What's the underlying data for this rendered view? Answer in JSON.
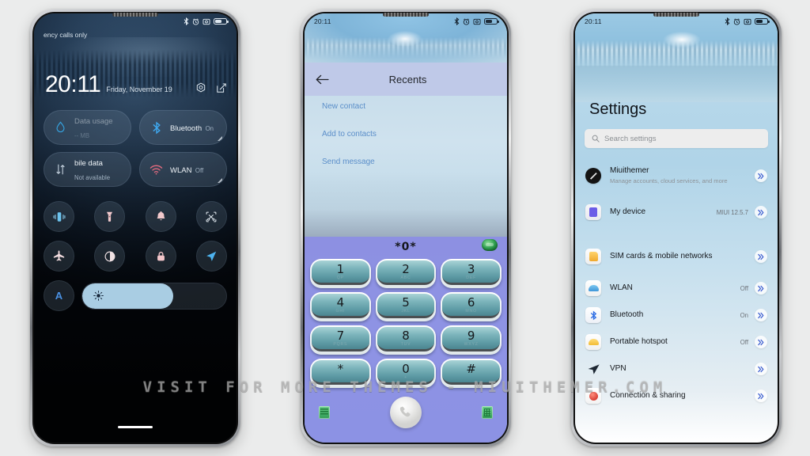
{
  "watermark": "VISIT FOR MORE THEMES - MIUITHEMER.COM",
  "colors": {
    "page_background": "#ebecec",
    "accent_blue": "#4f86c6",
    "dialpad_purple": "#8d90e2",
    "key_teal": "#5d9aa4",
    "brightness_fill": "#a9cde3",
    "settings_chevron": "#3e5fd0"
  },
  "phone1": {
    "status": {
      "carrier": "ency calls only",
      "icons": [
        "bluetooth-icon",
        "alarm-icon",
        "screenshot-icon",
        "battery-icon"
      ]
    },
    "lock": {
      "time": "20:11",
      "date": "Friday, November 19",
      "actions": [
        "camera-settings-icon",
        "edit-icon"
      ]
    },
    "tiles": [
      {
        "name": "Data usage",
        "sub": "-- MB",
        "icon": "data-drop-icon",
        "faded": true
      },
      {
        "name": "Bluetooth",
        "sub": "On",
        "icon": "bluetooth-icon",
        "faded": false
      },
      {
        "name": "bile data",
        "sub": "Not available",
        "icon": "mobile-data-icon",
        "faded": false
      },
      {
        "name": "WLAN",
        "sub": "Off",
        "icon": "wifi-icon",
        "faded": false
      }
    ],
    "quick_toggles": [
      "vibrate-icon",
      "flashlight-icon",
      "ringer-bell-icon",
      "screenshot-scissors-icon",
      "airplane-icon",
      "dark-mode-icon",
      "lock-icon",
      "location-icon"
    ],
    "brightness": {
      "auto_label": "A",
      "icon": "sun-brightness-icon",
      "level": "63"
    }
  },
  "phone2": {
    "status": {
      "time": "20:11",
      "icons": [
        "bluetooth-icon",
        "alarm-icon",
        "screenshot-icon",
        "battery-icon"
      ]
    },
    "header": {
      "back": "back-arrow-icon",
      "title": "Recents"
    },
    "links": [
      "New contact",
      "Add to contacts",
      "Send message"
    ],
    "dialer": {
      "number": "*0*",
      "message_icon": "message-bubble-icon",
      "keys": [
        {
          "main": "1",
          "sub": "QP"
        },
        {
          "main": "2",
          "sub": "ABC"
        },
        {
          "main": "3",
          "sub": "DEF"
        },
        {
          "main": "4",
          "sub": "GHI"
        },
        {
          "main": "5",
          "sub": "JKL"
        },
        {
          "main": "6",
          "sub": "MNO"
        },
        {
          "main": "7",
          "sub": "PQRS"
        },
        {
          "main": "8",
          "sub": "TUV"
        },
        {
          "main": "9",
          "sub": "WXYZ"
        },
        {
          "main": "*",
          "sub": ""
        },
        {
          "main": "0",
          "sub": "+"
        },
        {
          "main": "#",
          "sub": ""
        }
      ],
      "bottom": {
        "left_icon": "notes-icon",
        "call_icon": "call-handset-icon",
        "right_icon": "keypad-icon"
      }
    }
  },
  "phone3": {
    "status": {
      "time": "20:11",
      "icons": [
        "bluetooth-icon",
        "alarm-icon",
        "screenshot-icon",
        "battery-icon"
      ]
    },
    "title": "Settings",
    "search": {
      "icon": "search-icon",
      "placeholder": "Search settings"
    },
    "items": [
      {
        "label": "Miuithemer",
        "desc": "Manage accounts, cloud services, and more",
        "value": "",
        "icon": "account-avatar",
        "icon_color": "#1a1a1a",
        "round": true,
        "tall": true
      },
      {
        "label": "My device",
        "desc": "",
        "value": "MIUI 12.5.7",
        "icon": "device-icon",
        "icon_color": "#6b5ce7",
        "round": false,
        "tall": false
      },
      {
        "label": "SIM cards & mobile networks",
        "desc": "",
        "value": "",
        "icon": "sim-card-icon",
        "icon_color": "#f2b134",
        "round": false,
        "tall": true
      },
      {
        "label": "WLAN",
        "desc": "",
        "value": "Off",
        "icon": "wifi-icon",
        "icon_color": "#5aa9e6",
        "round": false,
        "tall": false
      },
      {
        "label": "Bluetooth",
        "desc": "",
        "value": "On",
        "icon": "bluetooth-icon",
        "icon_color": "#2f6fe4",
        "round": false,
        "tall": false
      },
      {
        "label": "Portable hotspot",
        "desc": "",
        "value": "Off",
        "icon": "hotspot-icon",
        "icon_color": "#f5c542",
        "round": false,
        "tall": false
      },
      {
        "label": "VPN",
        "desc": "",
        "value": "",
        "icon": "vpn-icon",
        "icon_color": "#1d2733",
        "round": false,
        "tall": false
      },
      {
        "label": "Connection & sharing",
        "desc": "",
        "value": "",
        "icon": "connection-sharing-icon",
        "icon_color": "#e05a4a",
        "round": false,
        "tall": false
      }
    ]
  }
}
